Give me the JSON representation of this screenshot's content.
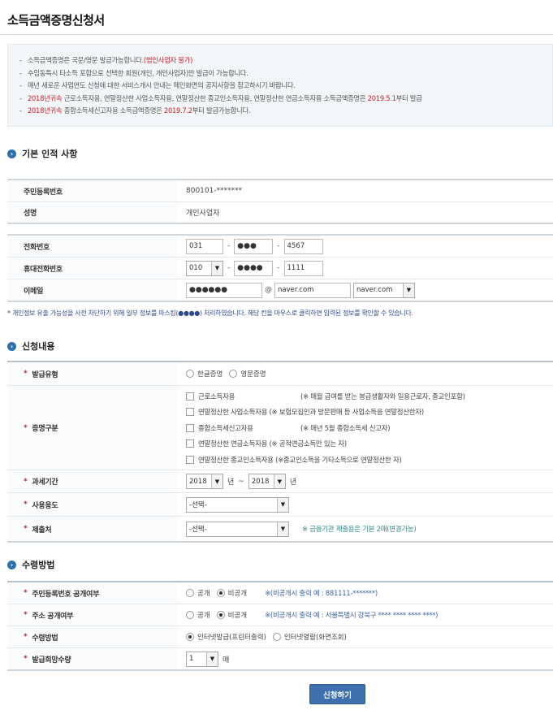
{
  "page": {
    "title": "소득금액증명신청서"
  },
  "notices": [
    {
      "text": "소득금액증명은 국문/영문 발급가능합니다.",
      "red": "(법인사업자 불가)",
      "tail": ""
    },
    {
      "text": "수임동특시 타소득 포함으로 선택한 회원(개인, 개인사업자)만 발급이 가능합니다.",
      "red": "",
      "tail": ""
    },
    {
      "text": "매년 새로운 사업연도 신청에 대한 서비스개시 안내는 메인화면의 공지사항을 참고하시기 바랍니다.",
      "red": "",
      "tail": ""
    },
    {
      "text": "",
      "red": "2018년귀속",
      "tail": " 근로소득자용, 연말정산한 사업소득자용, 연말정산한 종교인소득자용, 연말정산한 연금소득자용 소득금액증명은 ",
      "red2": "2019.5.1",
      "tail2": "부터 발급"
    },
    {
      "text": "",
      "red": "2018년귀속",
      "tail": " 종합소득세신고자용 소득금액증명은 ",
      "red2": "2019.7.2",
      "tail2": "부터 발급가능합니다."
    }
  ],
  "basic": {
    "title": "기본 인적 사항",
    "rrn_label": "주민등록번호",
    "rrn_value": "800101-*******",
    "name_label": "성명",
    "name_value": "개인사업자",
    "phone_label": "전화번호",
    "phone": [
      "031",
      "●●●",
      "4567"
    ],
    "mobile_label": "휴대전화번호",
    "mobile": [
      "010",
      "●●●●",
      "1111"
    ],
    "email_label": "이메일",
    "email_id": "●●●●●●",
    "email_at": "@",
    "email_domain": "naver.com",
    "email_select": "naver.com",
    "mask_note": "* 개인정보 유출 가능성을 사전 차단하기 위해 일부 정보를 마스킹(●●●●) 처리하였습니다. 해당 칸을 마우스로 클릭하면 입력된 정보를 확인할 수 있습니다."
  },
  "apply": {
    "title": "신청내용",
    "issue_type_label": "발급유형",
    "issue_types": [
      "한글증명",
      "영문증명"
    ],
    "cert_type_label": "증명구분",
    "cert_types": [
      {
        "label": "근로소득자용",
        "desc": "(※ 매월 급여를 받는 봉급생활자와 일용근로자, 종교인포함)"
      },
      {
        "label": "연말정산한 사업소득자용",
        "desc": "(※ 보험모집인과 방문판매 등 사업소득을 연말정산한자)"
      },
      {
        "label": "종합소득세신고자용",
        "desc": "(※ 매년 5월 종합소득세 신고자)"
      },
      {
        "label": "연말정산한 연금소득자용",
        "desc": "(※ 공적연금소득만 있는 자)"
      },
      {
        "label": "연말정산한 종교인소득자용",
        "desc": "(※종교인소득을 기타소득으로 연말정산한 자)"
      }
    ],
    "period_label": "과세기간",
    "period_from": "2018",
    "period_year_unit": "년",
    "period_tilde": "~",
    "period_to": "2018",
    "usage_label": "사용용도",
    "usage_value": "-선택-",
    "submit_to_label": "제출처",
    "submit_to_value": "-선택-",
    "submit_hint": "※ 금융기관 제출용은 기본 2매(변경가능)"
  },
  "receive": {
    "title": "수령방법",
    "rrn_open_label": "주민등록번호 공개여부",
    "open_options": [
      "공개",
      "비공개"
    ],
    "rrn_hint": "※(비공개시 출력 예 : 881111-*******)",
    "addr_open_label": "주소 공개여부",
    "addr_hint": "※(비공개시 출력 예 : 서울특별시 강북구 **** **** **** ****)",
    "method_label": "수령방법",
    "methods": [
      "인터넷발급(프린터출력)",
      "인터넷열람(화면조회)"
    ],
    "qty_label": "발급희망수량",
    "qty_value": "1",
    "qty_unit": "매"
  },
  "submit_label": "신청하기"
}
